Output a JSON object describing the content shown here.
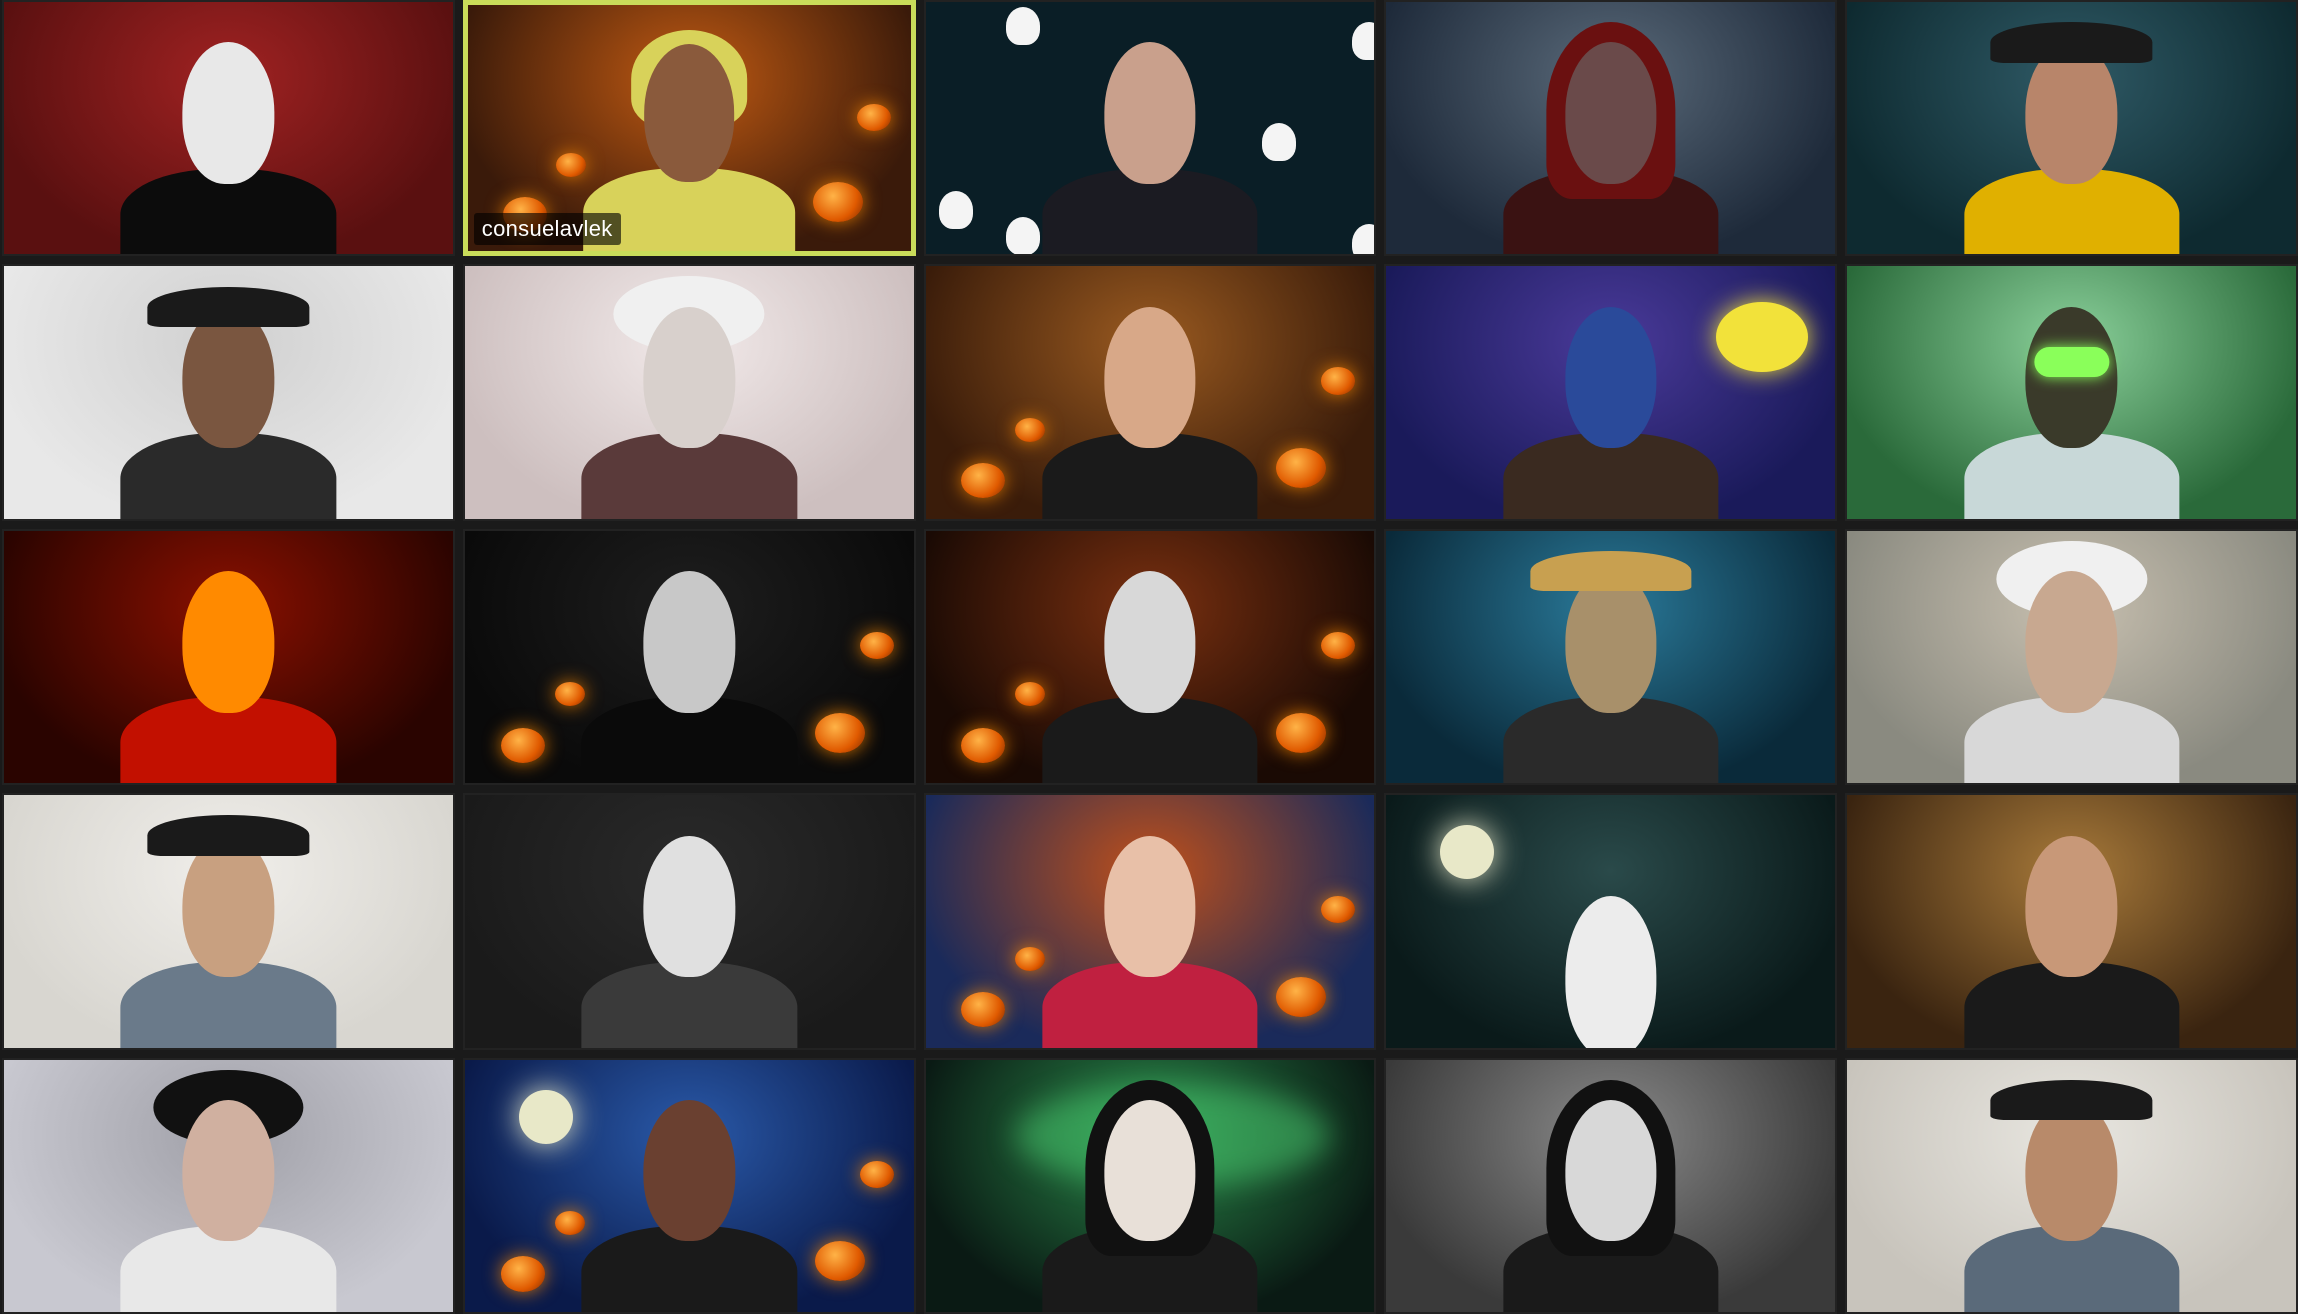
{
  "window": {
    "view": "gallery"
  },
  "participants": [
    {
      "name": "",
      "costume": "no-face-mask",
      "bg": "#5a1010",
      "bg2": "#a02222",
      "skin": "#e8e8e8",
      "cloth": "#0c0c0c"
    },
    {
      "name": "consuelavlek",
      "costume": "pikachu-hood",
      "bg": "#3a1a0a",
      "bg2": "#c15a12",
      "skin": "#8a5a3c",
      "cloth": "#d8d25a",
      "speaking": true
    },
    {
      "name": "",
      "costume": "ghosts-bg",
      "bg": "#0a1e26",
      "bg2": "#0a1e26",
      "skin": "#c9a08c",
      "cloth": "#1b1b22"
    },
    {
      "name": "",
      "costume": "red-hood",
      "bg": "#1e2a3a",
      "bg2": "#5a6a7a",
      "skin": "#6a4a4a",
      "cloth": "#3a1212"
    },
    {
      "name": "",
      "costume": "bandit-mask",
      "bg": "#0e2a30",
      "bg2": "#2f5a66",
      "skin": "#b8856a",
      "cloth": "#e0b000"
    },
    {
      "name": "",
      "costume": "witch-hat",
      "bg": "#e8e8e8",
      "bg2": "#d0d0d0",
      "skin": "#7a5640",
      "cloth": "#2a2a2a"
    },
    {
      "name": "",
      "costume": "white-headdress",
      "bg": "#cdbfbf",
      "bg2": "#f2eaea",
      "skin": "#d8d0cc",
      "cloth": "#5a3a3a"
    },
    {
      "name": "",
      "costume": "great-hall",
      "bg": "#3a1c0a",
      "bg2": "#9a5a20",
      "skin": "#d8a888",
      "cloth": "#1a1a1a"
    },
    {
      "name": "",
      "costume": "purge-mask",
      "bg": "#1a1a5a",
      "bg2": "#4a3a9a",
      "skin": "#2a4a9a",
      "cloth": "#3a2a20"
    },
    {
      "name": "",
      "costume": "gas-mask",
      "bg": "#2a6a3a",
      "bg2": "#8ad09a",
      "skin": "#3a3a2a",
      "cloth": "#c8d8d8"
    },
    {
      "name": "",
      "costume": "thermal",
      "bg": "#2a0400",
      "bg2": "#8a1000",
      "skin": "#ff8a00",
      "cloth": "#c21000"
    },
    {
      "name": "",
      "costume": "pale-ghoul",
      "bg": "#0a0a0a",
      "bg2": "#1e1e1e",
      "skin": "#c8c8c8",
      "cloth": "#0a0a0a"
    },
    {
      "name": "",
      "costume": "skull-makeup",
      "bg": "#1a0a04",
      "bg2": "#7a3010",
      "skin": "#d8d8d8",
      "cloth": "#1a1a1a"
    },
    {
      "name": "",
      "costume": "fedora",
      "bg": "#0a2a3a",
      "bg2": "#2a7a9a",
      "skin": "#a8906a",
      "cloth": "#2a2a2a"
    },
    {
      "name": "",
      "costume": "mad-scientist",
      "bg": "#8a8a80",
      "bg2": "#c8c0b0",
      "skin": "#c8a890",
      "cloth": "#d8d8d8"
    },
    {
      "name": "",
      "costume": "pirate-hat",
      "bg": "#d8d6d0",
      "bg2": "#f0eeea",
      "skin": "#c8a080",
      "cloth": "#6a7a8a"
    },
    {
      "name": "",
      "costume": "skull-reaper",
      "bg": "#1a1a1a",
      "bg2": "#2a2a2a",
      "skin": "#e0e0e0",
      "cloth": "#3a3a3a"
    },
    {
      "name": "",
      "costume": "red-lips",
      "bg": "#1a2a5a",
      "bg2": "#c0501a",
      "skin": "#e8c0a8",
      "cloth": "#c02040"
    },
    {
      "name": "",
      "costume": "sheet-ghost",
      "bg": "#0a1a1a",
      "bg2": "#2a4a4a",
      "skin": "#ececec",
      "cloth": "#ececec"
    },
    {
      "name": "",
      "costume": "hogwarts",
      "bg": "#3a2410",
      "bg2": "#a87a3a",
      "skin": "#c89878",
      "cloth": "#1a1a1a"
    },
    {
      "name": "",
      "costume": "punk-hair",
      "bg": "#c8c8d0",
      "bg2": "#a0a0a8",
      "skin": "#d0b0a0",
      "cloth": "#e8e8e8"
    },
    {
      "name": "",
      "costume": "spooky-night",
      "bg": "#0a1a4a",
      "bg2": "#2a5aaa",
      "skin": "#6a4030",
      "cloth": "#1a1a1a"
    },
    {
      "name": "",
      "costume": "scream-mask",
      "bg": "#0a1a14",
      "bg2": "#2a8a4a",
      "skin": "#e8e0d8",
      "cloth": "#1a1a1a"
    },
    {
      "name": "",
      "costume": "grim-skull",
      "bg": "#3a3a3a",
      "bg2": "#8a8a8a",
      "skin": "#d8d8d8",
      "cloth": "#1a1a1a"
    },
    {
      "name": "",
      "costume": "zorro",
      "bg": "#c8c4bc",
      "bg2": "#e8e6e0",
      "skin": "#b88a6a",
      "cloth": "#5a6a7a"
    }
  ]
}
